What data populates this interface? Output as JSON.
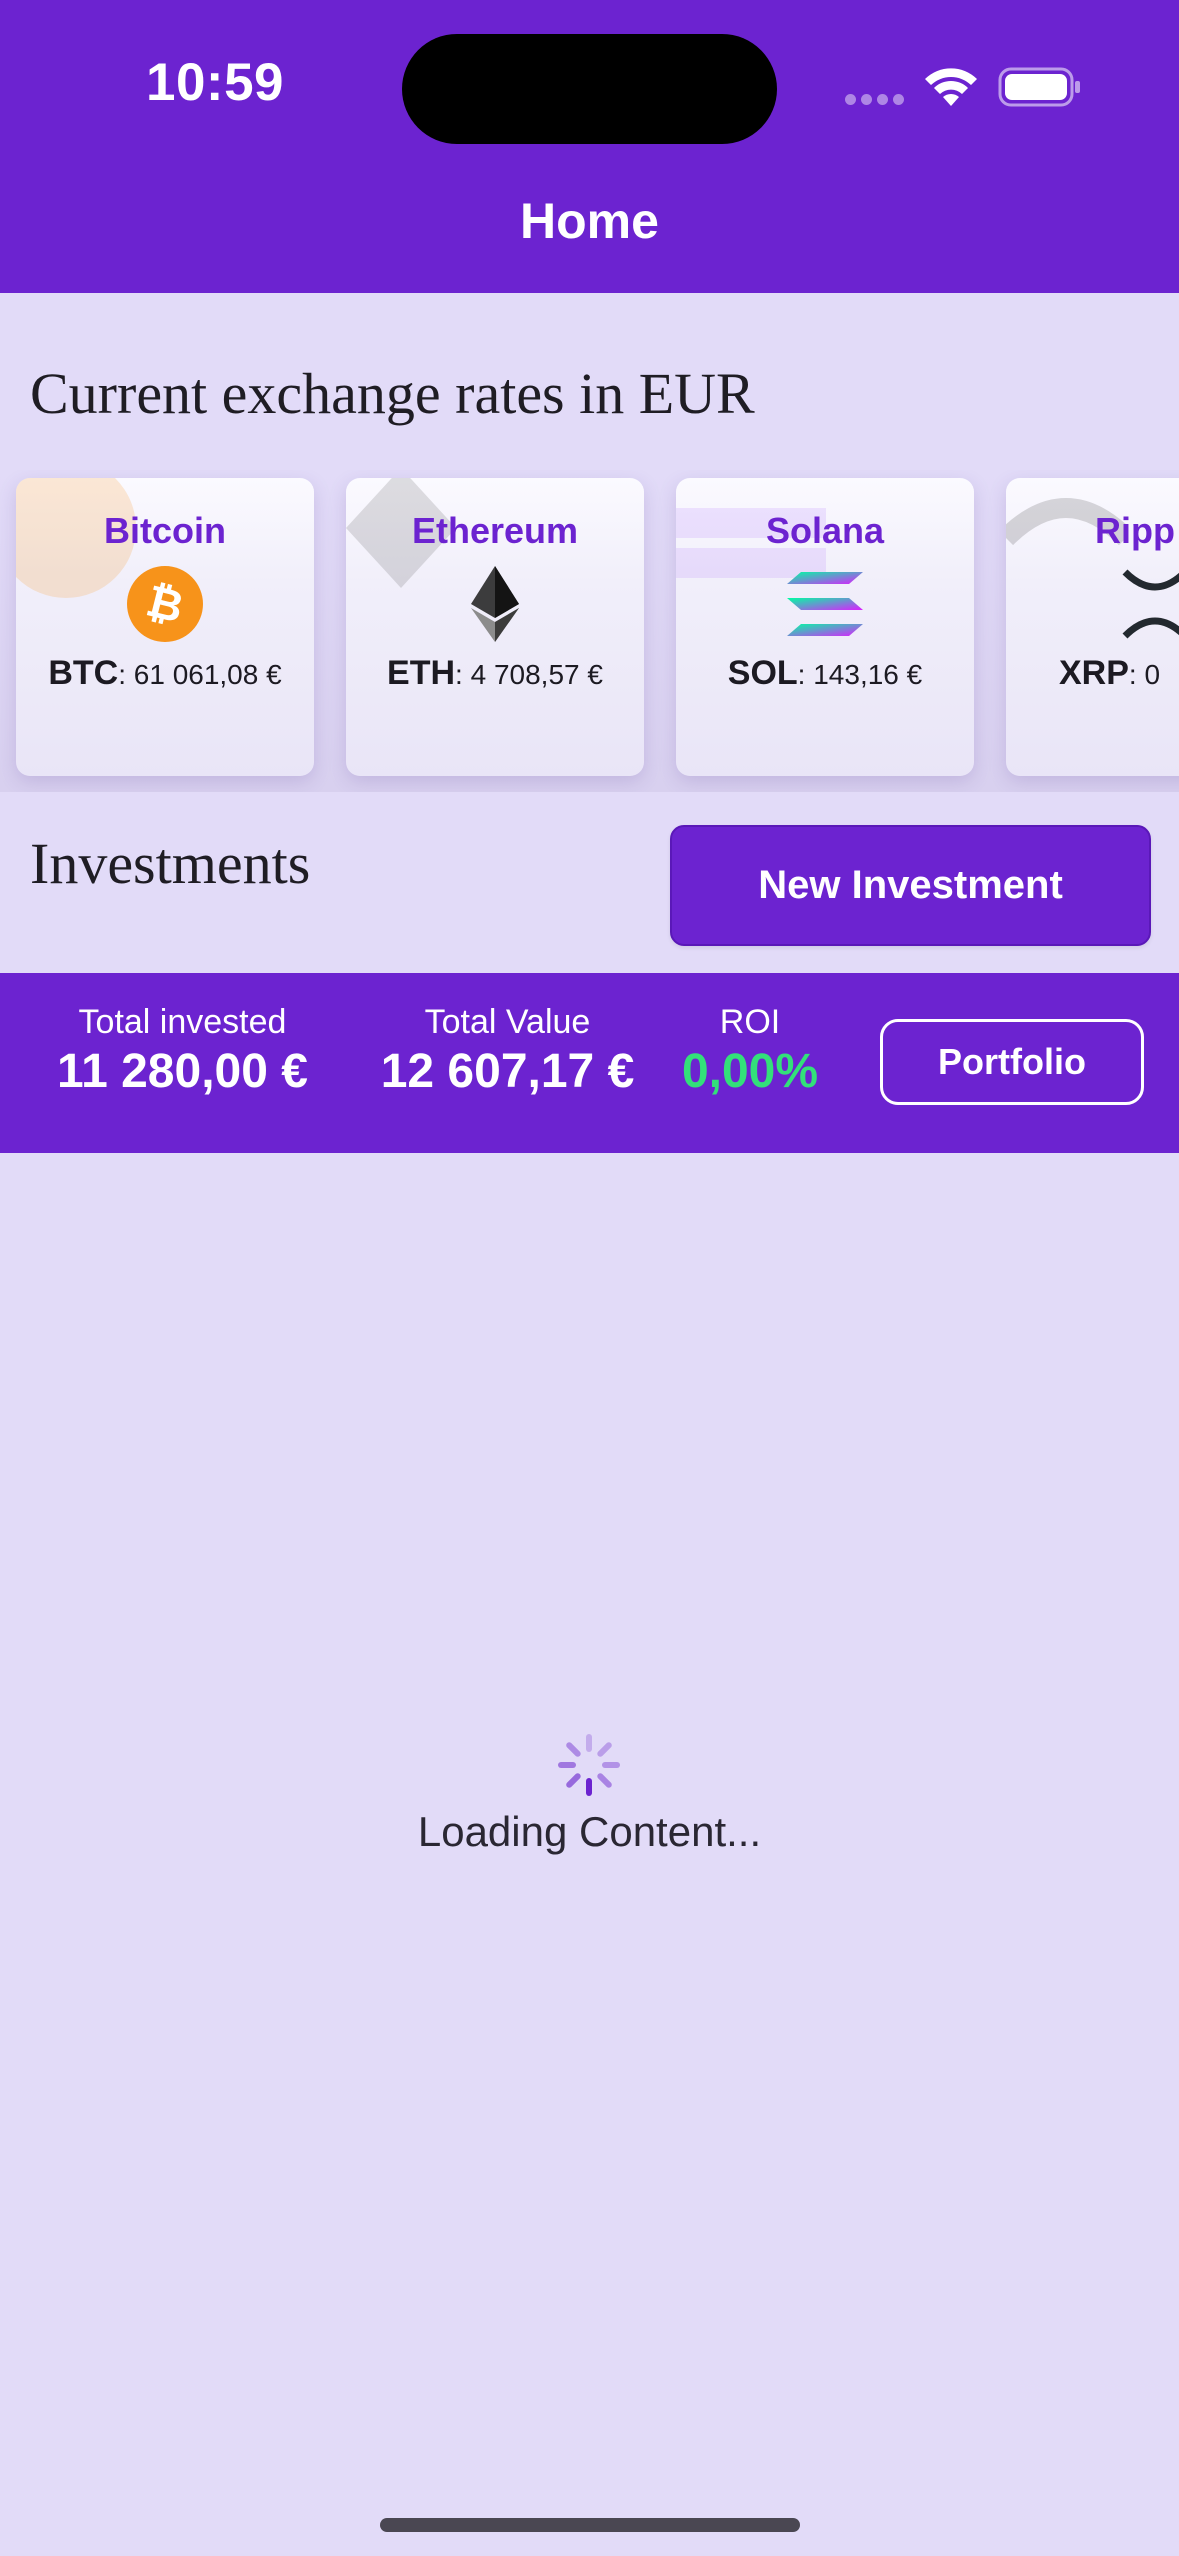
{
  "status_bar": {
    "time": "10:59"
  },
  "nav": {
    "title": "Home"
  },
  "rates": {
    "title": "Current exchange rates in EUR",
    "cards": [
      {
        "name": "Bitcoin",
        "symbol": "BTC",
        "sep": ":",
        "price": "61 061,08 €",
        "icon": "bitcoin-icon",
        "color": "#f7931a"
      },
      {
        "name": "Ethereum",
        "symbol": "ETH",
        "sep": ":",
        "price": "4 708,57 €",
        "icon": "ethereum-icon",
        "color": "#343434"
      },
      {
        "name": "Solana",
        "symbol": "SOL",
        "sep": ":",
        "price": "143,16 €",
        "icon": "solana-icon",
        "color": "#9945ff"
      },
      {
        "name": "Ripp",
        "symbol": "XRP",
        "sep": ":",
        "price": "0",
        "icon": "xrp-icon",
        "color": "#23292f"
      }
    ]
  },
  "investments": {
    "title": "Investments",
    "new_button": "New Investment"
  },
  "summary": {
    "total_invested_label": "Total invested",
    "total_invested_value": "11 280,00 €",
    "total_value_label": "Total Value",
    "total_value_value": "12 607,17 €",
    "roi_label": "ROI",
    "roi_value": "0,00%",
    "portfolio_button": "Portfolio"
  },
  "loading": {
    "text": "Loading Content..."
  },
  "colors": {
    "accent": "#6c23d0",
    "background": "#e2dbf8",
    "roi_positive": "#33e07a"
  }
}
